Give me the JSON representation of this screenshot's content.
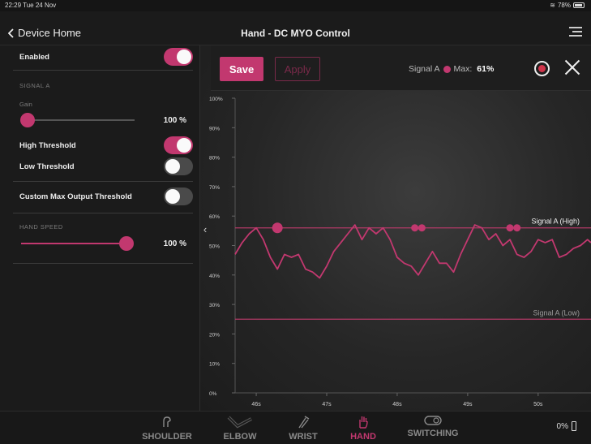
{
  "status_bar": {
    "time": "22:29",
    "date": "Tue 24 Nov",
    "battery": "78%"
  },
  "navbar": {
    "back_label": "Device Home",
    "title": "Hand - DC MYO Control",
    "menu_icon": "hamburger-menu-icon"
  },
  "sidebar": {
    "enabled": {
      "label": "Enabled",
      "on": true
    },
    "signal_a_section": "SIGNAL A",
    "gain": {
      "label": "Gain",
      "value_text": "100 %",
      "value": 0
    },
    "high_threshold": {
      "label": "High Threshold",
      "on": true
    },
    "low_threshold": {
      "label": "Low Threshold",
      "on": false
    },
    "custom_max": {
      "label": "Custom Max Output Threshold",
      "on": false
    },
    "hand_speed_section": "HAND SPEED",
    "hand_speed": {
      "value_text": "100 %",
      "value": 1
    }
  },
  "toolbar": {
    "save_label": "Save",
    "apply_label": "Apply",
    "signal_label": "Signal A",
    "max_label": "Max:",
    "max_value": "61%"
  },
  "colors": {
    "accent": "#c2386f",
    "threshold_line": "#b13a66",
    "record": "#d0344a"
  },
  "chart_data": {
    "type": "line",
    "y_ticks": [
      "100%",
      "90%",
      "80%",
      "70%",
      "60%",
      "50%",
      "40%",
      "30%",
      "20%",
      "10%",
      "0%"
    ],
    "ylim": [
      0,
      100
    ],
    "x_ticks": [
      "46s",
      "47s",
      "48s",
      "49s",
      "50s"
    ],
    "x_tick_values": [
      46,
      47,
      48,
      49,
      50
    ],
    "xlim": [
      45.7,
      50.75
    ],
    "thresholds": [
      {
        "name": "Signal A (High)",
        "value": 56
      },
      {
        "name": "Signal A (Low)",
        "value": 25
      }
    ],
    "series": [
      {
        "name": "Signal A",
        "x": [
          45.7,
          45.8,
          45.9,
          46.0,
          46.1,
          46.2,
          46.3,
          46.4,
          46.5,
          46.6,
          46.7,
          46.8,
          46.9,
          47.0,
          47.1,
          47.2,
          47.3,
          47.4,
          47.5,
          47.6,
          47.7,
          47.8,
          47.9,
          48.0,
          48.1,
          48.2,
          48.3,
          48.4,
          48.5,
          48.6,
          48.7,
          48.8,
          48.9,
          49.0,
          49.1,
          49.2,
          49.3,
          49.4,
          49.5,
          49.6,
          49.7,
          49.8,
          49.9,
          50.0,
          50.1,
          50.2,
          50.3,
          50.4,
          50.5,
          50.6,
          50.7,
          50.75
        ],
        "y": [
          47,
          51,
          54,
          56,
          52,
          46,
          42,
          47,
          46,
          47,
          42,
          41,
          39,
          43,
          48,
          51,
          54,
          57,
          52,
          56,
          54,
          56,
          52,
          46,
          44,
          43,
          40,
          44,
          48,
          44,
          44,
          41,
          47,
          52,
          57,
          56,
          52,
          54,
          50,
          52,
          47,
          46,
          48,
          52,
          51,
          52,
          46,
          47,
          49,
          50,
          52,
          51
        ]
      }
    ],
    "markers": [
      {
        "x": 46.3,
        "y": 56
      },
      {
        "x": 48.25,
        "y": 56
      },
      {
        "x": 48.35,
        "y": 56
      },
      {
        "x": 49.6,
        "y": 56
      },
      {
        "x": 49.7,
        "y": 56
      }
    ],
    "grid": false
  },
  "tabs": [
    {
      "label": "SHOULDER",
      "icon": "shoulder-icon",
      "active": false
    },
    {
      "label": "ELBOW",
      "icon": "elbow-icon",
      "active": false
    },
    {
      "label": "WRIST",
      "icon": "wrist-icon",
      "active": false
    },
    {
      "label": "HAND",
      "icon": "hand-icon",
      "active": true
    },
    {
      "label": "SWITCHING",
      "icon": "switching-icon",
      "active": false
    }
  ],
  "device_battery": "0%"
}
